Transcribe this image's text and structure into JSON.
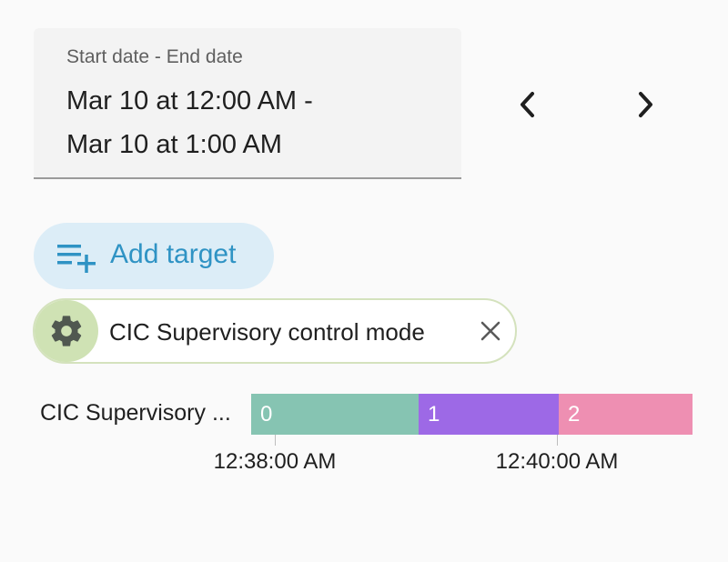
{
  "date_range": {
    "label": "Start date - End date",
    "line1": "Mar 10 at 12:00 AM -",
    "line2": "Mar 10 at 1:00 AM"
  },
  "nav": {
    "prev_icon": "chevron-left-icon",
    "next_icon": "chevron-right-icon"
  },
  "add_target": {
    "label": "Add target",
    "icon": "playlist-plus-icon",
    "color": "#2f93c4",
    "background": "#dcedf7"
  },
  "target_chip": {
    "label": "CIC Supervisory control mode",
    "icon": "gear-icon",
    "close_icon": "close-icon"
  },
  "timeline": {
    "entity_label": "CIC Supervisory ...",
    "segments": [
      {
        "value": "0",
        "color": "#86c4b2"
      },
      {
        "value": "1",
        "color": "#9d69e6"
      },
      {
        "value": "2",
        "color": "#ee8fb2"
      }
    ],
    "ticks": [
      "12:38:00 AM",
      "12:40:00 AM"
    ]
  }
}
